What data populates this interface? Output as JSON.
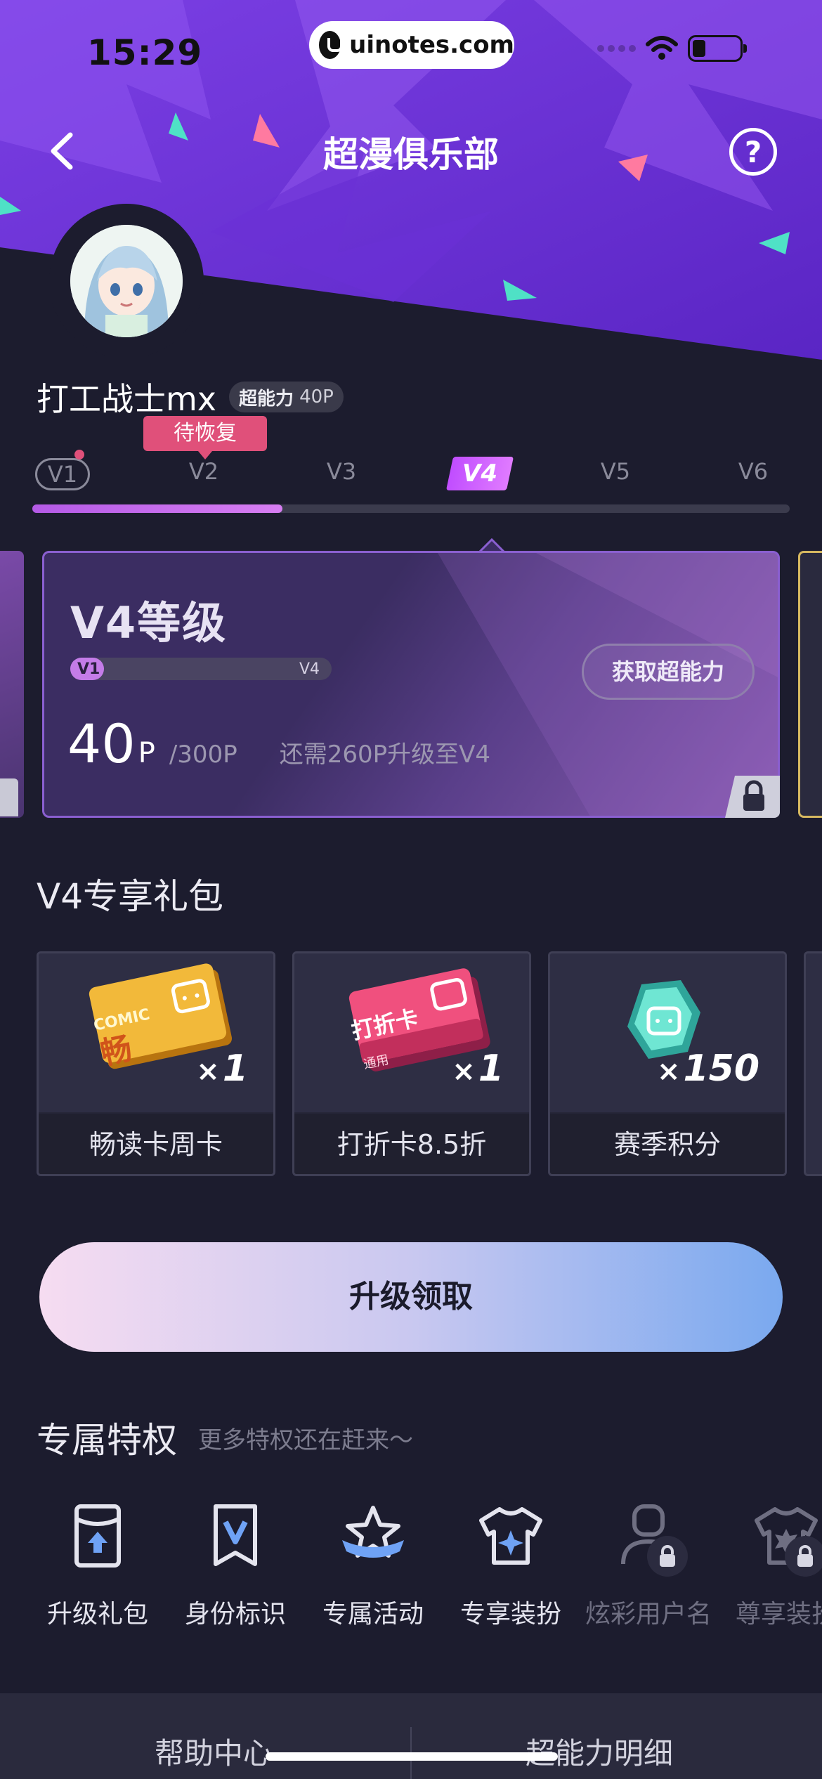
{
  "status_bar": {
    "time": "15:29",
    "url": "uinotes.com"
  },
  "nav": {
    "title": "超漫俱乐部",
    "help_glyph": "?"
  },
  "user": {
    "name": "打工战士mx",
    "power_label": "超能力",
    "power_value": "40P"
  },
  "levels": {
    "pending_tag": "待恢复",
    "items": [
      "V1",
      "V2",
      "V3",
      "V4",
      "V5",
      "V6"
    ],
    "current": "V4",
    "progress_fraction": 0.33
  },
  "level_card": {
    "title": "V4等级",
    "mini_from": "V1",
    "mini_to": "V4",
    "mini_progress_fraction": 0.13,
    "get_power_button": "获取超能力",
    "points": "40",
    "points_unit": "P",
    "points_total": "/300P",
    "points_need": "还需260P升级至V4"
  },
  "gifts": {
    "title": "V4专享礼包",
    "items": [
      {
        "label": "畅读卡周卡",
        "count": "1",
        "card_text": "COMIC",
        "card_char": "畅"
      },
      {
        "label": "打折卡8.5折",
        "count": "1",
        "card_text": "打折卡",
        "card_sub": "通用"
      },
      {
        "label": "赛季积分",
        "count": "150"
      }
    ],
    "multiply_sign": "×"
  },
  "upgrade_button": "升级领取",
  "privileges": {
    "title": "专属特权",
    "subtitle": "更多特权还在赶来～",
    "items": [
      {
        "label": "升级礼包",
        "icon": "gift-upgrade-icon",
        "locked": false
      },
      {
        "label": "身份标识",
        "icon": "v-badge-icon",
        "locked": false
      },
      {
        "label": "专属活动",
        "icon": "star-ribbon-icon",
        "locked": false
      },
      {
        "label": "专享装扮",
        "icon": "shirt-icon",
        "locked": false
      },
      {
        "label": "炫彩用户名",
        "icon": "user-icon",
        "locked": true
      },
      {
        "label": "尊享装扮",
        "icon": "shirt-sparkle-icon",
        "locked": true
      }
    ]
  },
  "bottom_bar": {
    "left": "帮助中心",
    "right": "超能力明细"
  },
  "colors": {
    "accent_purple": "#7a3ee0",
    "pending_pink": "#e0507a",
    "background": "#1c1c2e"
  }
}
